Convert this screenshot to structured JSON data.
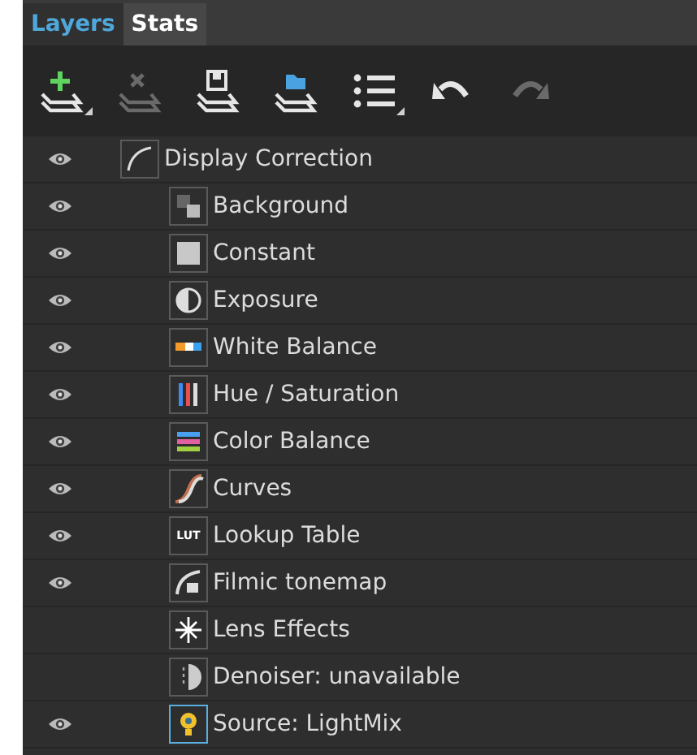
{
  "tabs": [
    {
      "label": "Layers",
      "selected": true
    },
    {
      "label": "Stats",
      "selected": false
    }
  ],
  "toolbar": [
    {
      "kind": "add",
      "disabled": false,
      "menu": true
    },
    {
      "kind": "remove",
      "disabled": true,
      "menu": false
    },
    {
      "kind": "save",
      "disabled": false,
      "menu": false
    },
    {
      "kind": "open",
      "disabled": false,
      "menu": false
    },
    {
      "kind": "list",
      "disabled": false,
      "menu": true
    },
    {
      "kind": "undo",
      "disabled": false,
      "menu": false
    },
    {
      "kind": "redo",
      "disabled": true,
      "menu": false
    }
  ],
  "layers": [
    {
      "name": "Display Correction",
      "kind": "curve",
      "visible": true,
      "selected": false,
      "children": [
        {
          "name": "Background",
          "kind": "background",
          "visible": true,
          "selected": false
        },
        {
          "name": "Constant",
          "kind": "constant",
          "visible": true,
          "selected": false
        },
        {
          "name": "Exposure",
          "kind": "exposure",
          "visible": true,
          "selected": false
        },
        {
          "name": "White Balance",
          "kind": "whitebalance",
          "visible": true,
          "selected": false
        },
        {
          "name": "Hue / Saturation",
          "kind": "hue",
          "visible": true,
          "selected": false
        },
        {
          "name": "Color Balance",
          "kind": "colorbalance",
          "visible": true,
          "selected": false
        },
        {
          "name": "Curves",
          "kind": "curves",
          "visible": true,
          "selected": false
        },
        {
          "name": "Lookup Table",
          "kind": "lut",
          "icon_text": "LUT",
          "visible": true,
          "selected": false
        },
        {
          "name": "Filmic tonemap",
          "kind": "filmic",
          "visible": true,
          "selected": false
        },
        {
          "name": "Lens Effects",
          "kind": "lens",
          "visible": false,
          "selected": false
        },
        {
          "name": "Denoiser: unavailable",
          "kind": "denoiser",
          "visible": false,
          "selected": false
        },
        {
          "name": "Source: LightMix",
          "kind": "source",
          "visible": true,
          "selected": true
        }
      ]
    }
  ]
}
